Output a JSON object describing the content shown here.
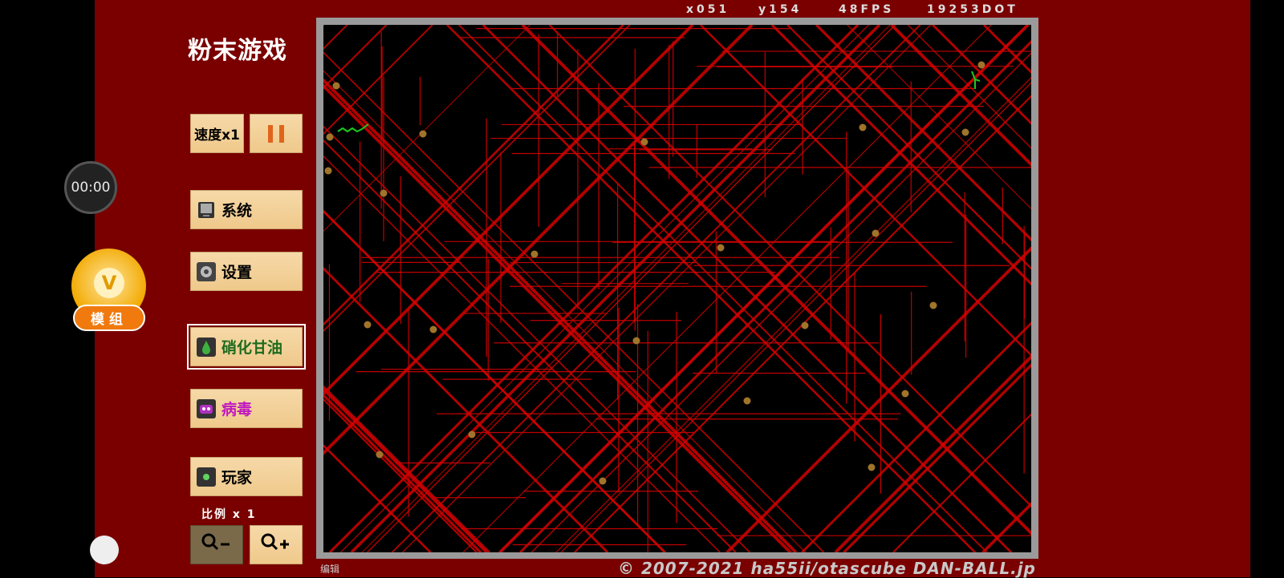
{
  "title": "粉末游戏",
  "controls": {
    "speed_label": "速度x1",
    "system_label": "系统",
    "settings_label": "设置",
    "element_nitro_label": "硝化甘油",
    "element_virus_label": "病毒",
    "player_label": "玩家",
    "scale_label": "比例 x 1"
  },
  "overlay": {
    "timer": "00:00",
    "mod_badge_label": "模组",
    "mod_crown": "V"
  },
  "stats": {
    "x": "x051",
    "y": "y154",
    "fps": "48FPS",
    "dot": "19253DOT"
  },
  "footer": {
    "edit_label": "编辑",
    "copyright": "© 2007-2021 ha55ii/otascube DAN-BALL.jp"
  },
  "colors": {
    "background": "#7a0000",
    "canvas": "#000000",
    "lines": "#d40000",
    "dots": "#a0742a",
    "player_green": "#22c922"
  },
  "icons": {
    "system": "monitor-icon",
    "settings": "gear-icon",
    "nitro": "drop-icon",
    "virus": "virus-icon",
    "player": "player-dot-icon",
    "zoom_out": "magnifier-minus-icon",
    "zoom_in": "magnifier-plus-icon"
  }
}
